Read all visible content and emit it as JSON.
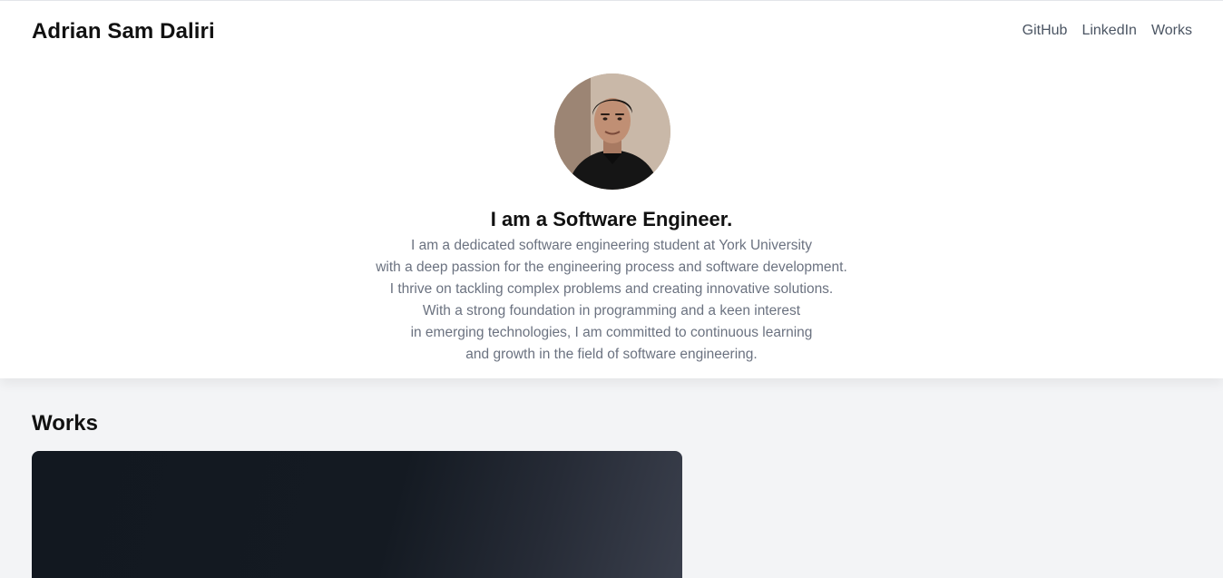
{
  "header": {
    "brand": "Adrian Sam Daliri",
    "nav": [
      {
        "label": "GitHub"
      },
      {
        "label": "LinkedIn"
      },
      {
        "label": "Works"
      }
    ]
  },
  "hero": {
    "headline": "I am a Software Engineer.",
    "bio_lines": [
      "I am a dedicated software engineering student at York University",
      "with a deep passion for the engineering process and software development.",
      "I thrive on tackling complex problems and creating innovative solutions.",
      "With a strong foundation in programming and a keen interest",
      "in emerging technologies, I am committed to continuous learning",
      "and growth in the field of software engineering."
    ]
  },
  "works": {
    "title": "Works"
  },
  "colors": {
    "page_background": "#f3f4f6",
    "hero_background": "#ffffff",
    "text_primary": "#111111",
    "text_muted": "#6b7280",
    "card_dark": "#121820"
  }
}
